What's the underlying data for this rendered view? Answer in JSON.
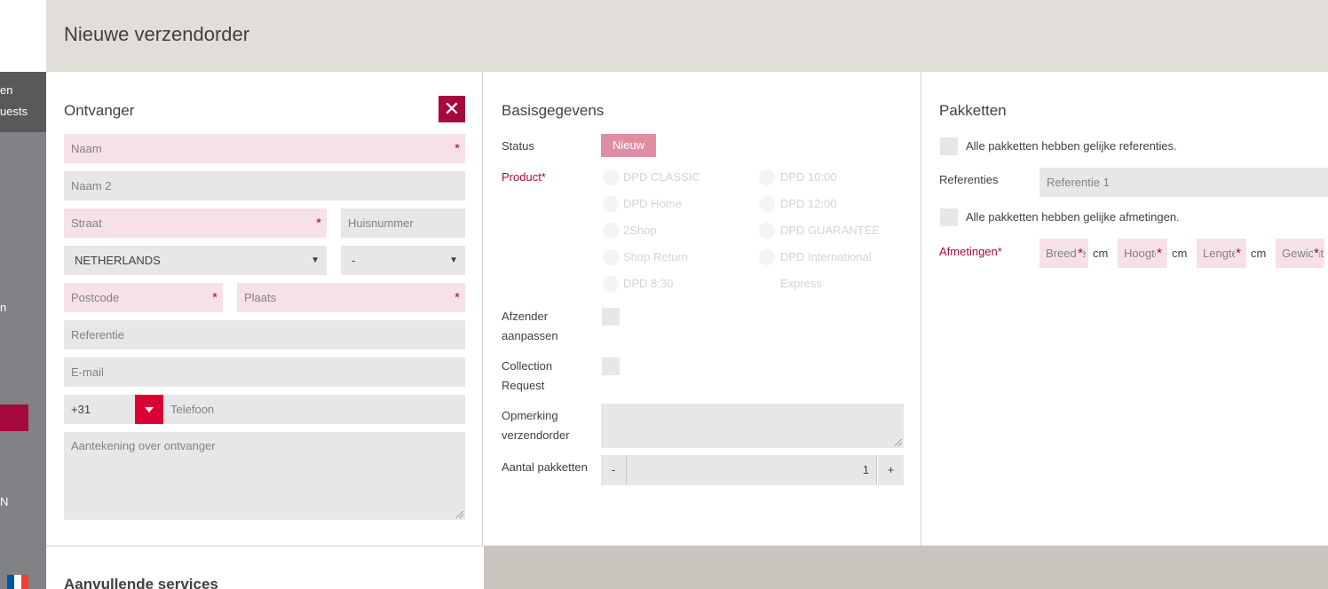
{
  "header": {
    "title": "Nieuwe verzendorder"
  },
  "sidebar": {
    "items": [
      {
        "label": "en"
      },
      {
        "label": "uests"
      },
      {
        "label": "n"
      },
      {
        "label": "N"
      }
    ]
  },
  "ontvanger": {
    "title": "Ontvanger",
    "close_icon": "close-icon",
    "naam_placeholder": "Naam",
    "naam2_placeholder": "Naam 2",
    "straat_placeholder": "Straat",
    "huisnummer_placeholder": "Huisnummer",
    "country_value": "NETHERLANDS",
    "state_value": "-",
    "postcode_placeholder": "Postcode",
    "plaats_placeholder": "Plaats",
    "referentie_placeholder": "Referentie",
    "email_placeholder": "E-mail",
    "phone_prefix": "+31",
    "telefoon_placeholder": "Telefoon",
    "aantekening_placeholder": "Aantekening over ontvanger",
    "required_mark": "*"
  },
  "basis": {
    "title": "Basisgegevens",
    "status_label": "Status",
    "status_value": "Nieuw",
    "product_label": "Product*",
    "products_left": [
      "DPD CLASSIC",
      "DPD Home",
      "2Shop",
      "Shop Return",
      "DPD 8:30"
    ],
    "products_right": [
      "DPD 10:00",
      "DPD 12:00",
      "DPD GUARANTEE",
      "DPD International",
      "Express"
    ],
    "afzender_label_1": "Afzender",
    "afzender_label_2": "aanpassen",
    "collection_label_1": "Collection",
    "collection_label_2": "Request",
    "opmerking_label_1": "Opmerking",
    "opmerking_label_2": "verzendorder",
    "aantal_label": "Aantal pakketten",
    "decrement": "-",
    "increment": "+",
    "aantal_value": "1"
  },
  "pakketten": {
    "title": "Pakketten",
    "gelijke_referenties": "Alle pakketten hebben gelijke referenties.",
    "referenties_label": "Referenties",
    "referentie_placeholder": "Referentie 1",
    "gelijke_afmetingen": "Alle pakketten hebben gelijke afmetingen.",
    "afmetingen_label": "Afmetingen*",
    "breedte": "Breedte",
    "hoogte": "Hoogte",
    "lengte": "Lengte",
    "gewicht": "Gewicht",
    "unit": "cm"
  },
  "aanvullende": {
    "title": "Aanvullende services"
  },
  "colors": {
    "accent": "#a6093d",
    "brand_red": "#dc0032",
    "required_bg": "#f6e1e6",
    "field_bg": "#e6e7e8"
  }
}
